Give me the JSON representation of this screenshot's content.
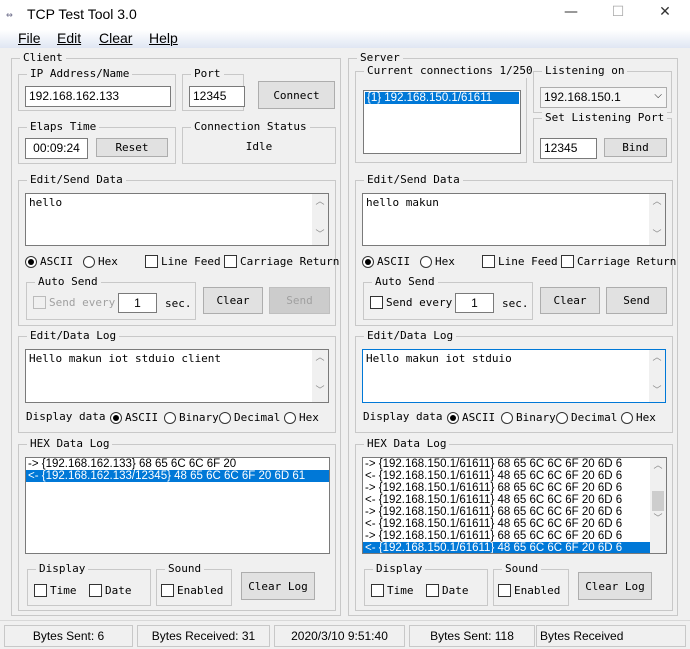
{
  "window": {
    "title": "TCP Test Tool 3.0",
    "minimize": "—",
    "maximize": "☐",
    "close": "✕"
  },
  "menu": [
    "File",
    "Edit",
    "Clear",
    "Help"
  ],
  "client": {
    "label": "Client",
    "ip_label": "IP Address/Name",
    "ip_value": "192.168.162.133",
    "port_label": "Port",
    "port_value": "12345",
    "connect": "Connect",
    "elaps_label": "Elaps Time",
    "elaps_value": "00:09:24",
    "reset": "Reset",
    "status_label": "Connection Status",
    "status_value": "Idle",
    "send_label": "Edit/Send Data",
    "send_text": "hello",
    "ascii": "ASCII",
    "hex": "Hex",
    "line_feed": "Line Feed",
    "carriage_return": "Carriage Return",
    "auto_send_label": "Auto Send",
    "send_every": "Send every",
    "interval": "1",
    "sec": "sec.",
    "clear": "Clear",
    "send": "Send",
    "log_label": "Edit/Data Log",
    "log_text": "Hello makun  iot stduio client",
    "display_data": "Display data",
    "binary": "Binary",
    "decimal": "Decimal",
    "hexlog_label": "HEX Data Log",
    "hexlog": [
      {
        "text": "-> {192.168.162.133} 68 65 6C 6C 6F 20",
        "selected": false
      },
      {
        "text": "<- {192.168.162.133/12345} 48 65 6C 6C 6F 20 6D 61",
        "selected": true
      }
    ],
    "display_label": "Display",
    "time": "Time",
    "date": "Date",
    "sound_label": "Sound",
    "enabled": "Enabled",
    "clear_log": "Clear Log"
  },
  "server": {
    "label": "Server",
    "connections_label": "Current connections 1/250",
    "connections": [
      "{1} 192.168.150.1/61611"
    ],
    "listening_label": "Listening on",
    "listening_value": "192.168.150.1",
    "port_label": "Set Listening Port",
    "port_value": "12345",
    "bind": "Bind",
    "send_label": "Edit/Send Data",
    "send_text": "hello makun",
    "ascii": "ASCII",
    "hex": "Hex",
    "line_feed": "Line Feed",
    "carriage_return": "Carriage Return",
    "auto_send_label": "Auto Send",
    "send_every": "Send every",
    "interval": "1",
    "sec": "sec.",
    "clear": "Clear",
    "send": "Send",
    "log_label": "Edit/Data Log",
    "log_text": "Hello makun  iot stduio",
    "display_data": "Display data",
    "binary": "Binary",
    "decimal": "Decimal",
    "hexlog_label": "HEX Data Log",
    "hexlog": [
      {
        "text": "-> {192.168.150.1/61611} 68 65 6C 6C 6F 20 6D 6",
        "selected": false
      },
      {
        "text": "<- {192.168.150.1/61611} 48 65 6C 6C 6F 20 6D 6",
        "selected": false
      },
      {
        "text": "-> {192.168.150.1/61611} 68 65 6C 6C 6F 20 6D 6",
        "selected": false
      },
      {
        "text": "<- {192.168.150.1/61611} 48 65 6C 6C 6F 20 6D 6",
        "selected": false
      },
      {
        "text": "-> {192.168.150.1/61611} 68 65 6C 6C 6F 20 6D 6",
        "selected": false
      },
      {
        "text": "<- {192.168.150.1/61611} 48 65 6C 6C 6F 20 6D 6",
        "selected": false
      },
      {
        "text": "-> {192.168.150.1/61611} 68 65 6C 6C 6F 20 6D 6",
        "selected": false
      },
      {
        "text": "<- {192.168.150.1/61611} 48 65 6C 6C 6F 20 6D 6",
        "selected": true
      }
    ],
    "display_label": "Display",
    "time": "Time",
    "date": "Date",
    "sound_label": "Sound",
    "enabled": "Enabled",
    "clear_log": "Clear Log"
  },
  "statusbar": {
    "client_sent": "Bytes Sent: 6",
    "client_received": "Bytes Received: 31",
    "datetime": "2020/3/10 9:51:40",
    "server_sent": "Bytes Sent: 118",
    "server_received": "Bytes Received"
  },
  "colors": {
    "selection": "#0078d7",
    "background": "#f0f0f0"
  }
}
